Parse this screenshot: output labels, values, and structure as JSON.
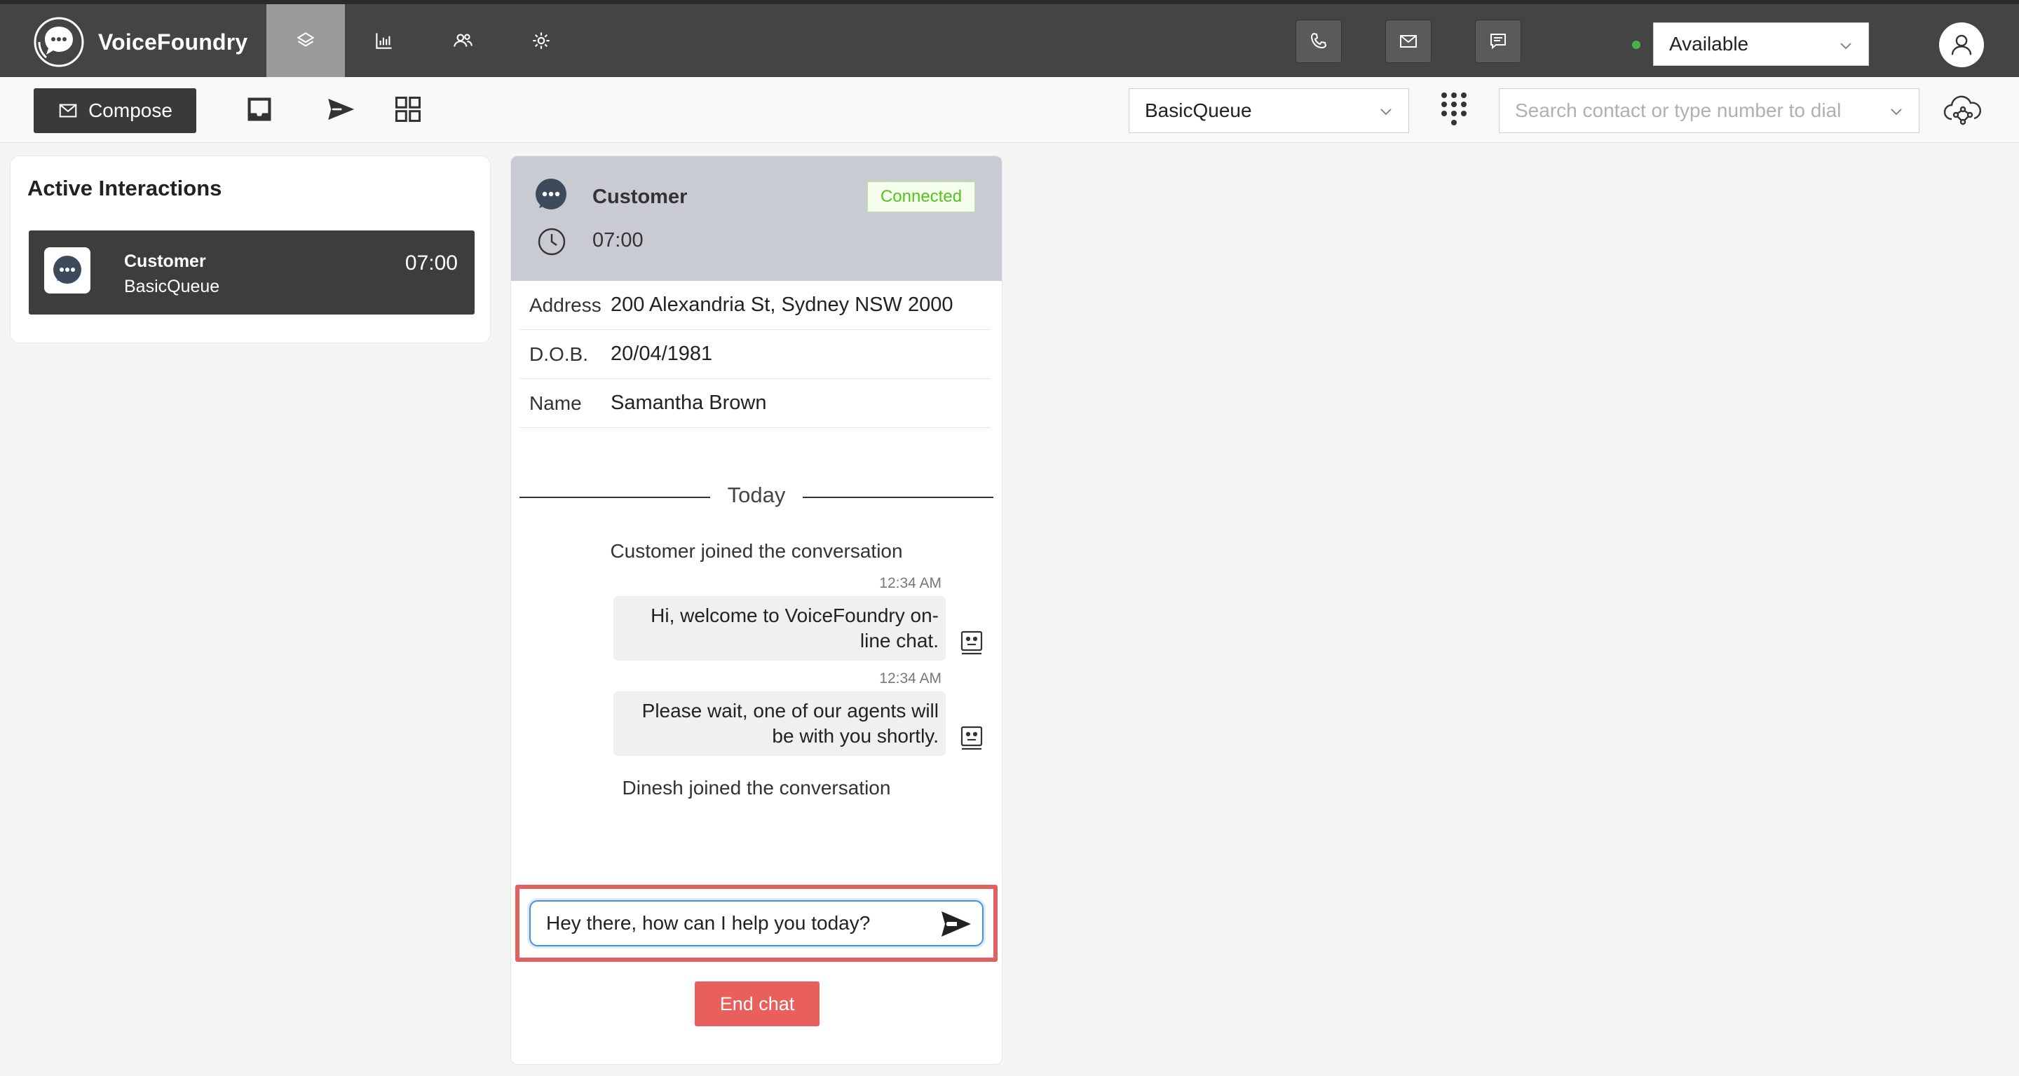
{
  "app": {
    "brand_name": "VoiceFoundry"
  },
  "topbar": {
    "status_value": "Available",
    "status_color": "#4caf50"
  },
  "toolbar": {
    "compose_label": "Compose",
    "queue_value": "BasicQueue",
    "search_placeholder": "Search contact or type number to dial"
  },
  "active_interactions": {
    "title": "Active Interactions",
    "items": [
      {
        "name": "Customer",
        "queue": "BasicQueue",
        "time": "07:00"
      }
    ]
  },
  "conversation": {
    "header": {
      "name": "Customer",
      "status": "Connected",
      "time": "07:00"
    },
    "details": [
      {
        "label": "Address",
        "value": "200 Alexandria St, Sydney NSW 2000"
      },
      {
        "label": "D.O.B.",
        "value": "20/04/1981"
      },
      {
        "label": "Name",
        "value": "Samantha Brown"
      }
    ],
    "date_divider": "Today",
    "events": {
      "customer_joined": "Customer joined the conversation",
      "agent_joined": "Dinesh joined the conversation"
    },
    "messages": [
      {
        "time": "12:34 AM",
        "line1": "Hi, welcome to VoiceFoundry on-",
        "line2": "line chat."
      },
      {
        "time": "12:34 AM",
        "line1": "Please wait, one of our agents will",
        "line2": "be with you shortly."
      }
    ],
    "input_value": "Hey there, how can I help you today?",
    "end_chat_label": "End chat"
  },
  "colors": {
    "topbar_bg": "#444444",
    "nav_active_bg": "#9a9a9a",
    "connected_green": "#52c41a",
    "end_chat_red": "#e85f5c",
    "highlight_red": "#e36060"
  }
}
